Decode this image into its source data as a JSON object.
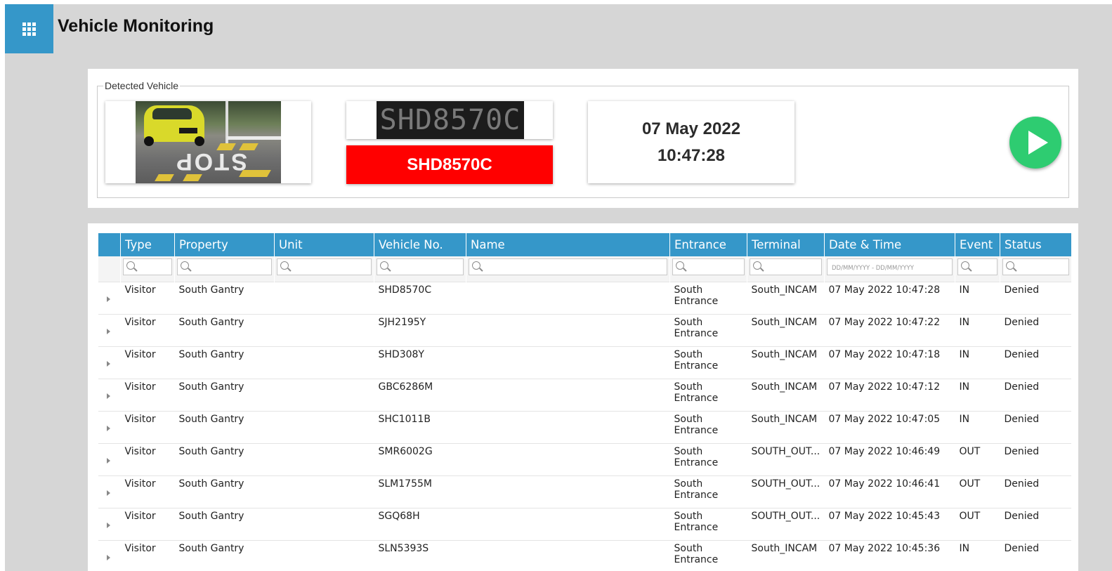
{
  "app": {
    "title": "Vehicle Monitoring"
  },
  "detected": {
    "legend": "Detected Vehicle",
    "plate_image_text": "SHD8570C",
    "plate_number": "SHD8570C",
    "date": "07 May 2022",
    "time": "10:47:28",
    "play_color": "#2ecc71",
    "plate_badge_color": "#ff0000"
  },
  "table": {
    "columns": [
      "Type",
      "Property",
      "Unit",
      "Vehicle No.",
      "Name",
      "Entrance",
      "Terminal",
      "Date & Time",
      "Event",
      "Status"
    ],
    "date_filter_placeholder": "DD/MM/YYYY - DD/MM/YYYY",
    "header_color": "#3597c9",
    "rows": [
      {
        "type": "Visitor",
        "property": "South Gantry",
        "unit": "",
        "vehicle": "SHD8570C",
        "name": "",
        "entrance": "South Entrance",
        "terminal": "South_INCAM",
        "datetime": "07 May 2022 10:47:28",
        "event": "IN",
        "status": "Denied"
      },
      {
        "type": "Visitor",
        "property": "South Gantry",
        "unit": "",
        "vehicle": "SJH2195Y",
        "name": "",
        "entrance": "South Entrance",
        "terminal": "South_INCAM",
        "datetime": "07 May 2022 10:47:22",
        "event": "IN",
        "status": "Denied"
      },
      {
        "type": "Visitor",
        "property": "South Gantry",
        "unit": "",
        "vehicle": "SHD308Y",
        "name": "",
        "entrance": "South Entrance",
        "terminal": "South_INCAM",
        "datetime": "07 May 2022 10:47:18",
        "event": "IN",
        "status": "Denied"
      },
      {
        "type": "Visitor",
        "property": "South Gantry",
        "unit": "",
        "vehicle": "GBC6286M",
        "name": "",
        "entrance": "South Entrance",
        "terminal": "South_INCAM",
        "datetime": "07 May 2022 10:47:12",
        "event": "IN",
        "status": "Denied"
      },
      {
        "type": "Visitor",
        "property": "South Gantry",
        "unit": "",
        "vehicle": "SHC1011B",
        "name": "",
        "entrance": "South Entrance",
        "terminal": "South_INCAM",
        "datetime": "07 May 2022 10:47:05",
        "event": "IN",
        "status": "Denied"
      },
      {
        "type": "Visitor",
        "property": "South Gantry",
        "unit": "",
        "vehicle": "SMR6002G",
        "name": "",
        "entrance": "South Entrance",
        "terminal": "SOUTH_OUT...",
        "datetime": "07 May 2022 10:46:49",
        "event": "OUT",
        "status": "Denied"
      },
      {
        "type": "Visitor",
        "property": "South Gantry",
        "unit": "",
        "vehicle": "SLM1755M",
        "name": "",
        "entrance": "South Entrance",
        "terminal": "SOUTH_OUT...",
        "datetime": "07 May 2022 10:46:41",
        "event": "OUT",
        "status": "Denied"
      },
      {
        "type": "Visitor",
        "property": "South Gantry",
        "unit": "",
        "vehicle": "SGQ68H",
        "name": "",
        "entrance": "South Entrance",
        "terminal": "SOUTH_OUT...",
        "datetime": "07 May 2022 10:45:43",
        "event": "OUT",
        "status": "Denied"
      },
      {
        "type": "Visitor",
        "property": "South Gantry",
        "unit": "",
        "vehicle": "SLN5393S",
        "name": "",
        "entrance": "South Entrance",
        "terminal": "South_INCAM",
        "datetime": "07 May 2022 10:45:36",
        "event": "IN",
        "status": "Denied"
      }
    ]
  }
}
